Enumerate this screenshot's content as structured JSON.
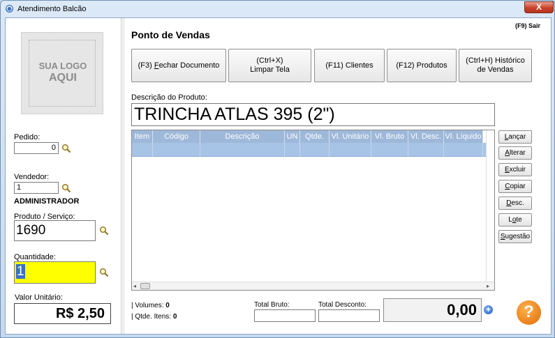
{
  "window": {
    "title": "Atendimento Balcão",
    "close_label": "X"
  },
  "logo": {
    "line1": "SUA LOGO",
    "line2": "AQUI"
  },
  "left_panel": {
    "pedido_label": "Pedido:",
    "pedido_value": "0",
    "vendedor_label": "Vendedor:",
    "vendedor_value": "1",
    "vendedor_name": "ADMINISTRADOR",
    "produto_label": "Produto / Serviço:",
    "produto_value": "1690",
    "quantidade_label": "Quantidade:",
    "quantidade_value": "1",
    "valor_label": "Valor Unitário:",
    "valor_value": "R$ 2,50"
  },
  "header": {
    "title": "Ponto de Vendas",
    "exit_label": "(F9) Sair"
  },
  "toolbar": [
    {
      "line1": "(F3) Fechar Documento",
      "line2": ""
    },
    {
      "line1": "(Ctrl+X)",
      "line2": "Limpar Tela"
    },
    {
      "line1": "(F11) Clientes",
      "line2": ""
    },
    {
      "line1": "(F12) Produtos",
      "line2": ""
    },
    {
      "line1": "(Ctrl+H) Histórico",
      "line2": "de Vendas"
    }
  ],
  "product": {
    "desc_label": "Descrição do Produto:",
    "desc_value": "TRINCHA ATLAS 395 (2\")"
  },
  "grid": {
    "columns": [
      "Item",
      "Código",
      "Descrição",
      "UN",
      "Qtde.",
      "Vl. Unitário",
      "Vl. Bruto",
      "Vl. Desc.",
      "Vl. Líquido"
    ]
  },
  "side_buttons": [
    "Lançar",
    "Alterar",
    "Excluir",
    "Copiar",
    "Desc.",
    "Lote",
    "Sugestão"
  ],
  "footer": {
    "volumes_label": "| Volumes:",
    "volumes_value": "0",
    "itens_label": "| Qtde. Itens:",
    "itens_value": "0",
    "total_bruto_label": "Total Bruto:",
    "total_desconto_label": "Total Desconto:",
    "total_value": "0,00"
  },
  "colors": {
    "highlight_field": "#ffff00",
    "grid_header": "#9eb8d9",
    "selected_row": "#a7c3e6",
    "help_orange": "#f08a1c"
  }
}
